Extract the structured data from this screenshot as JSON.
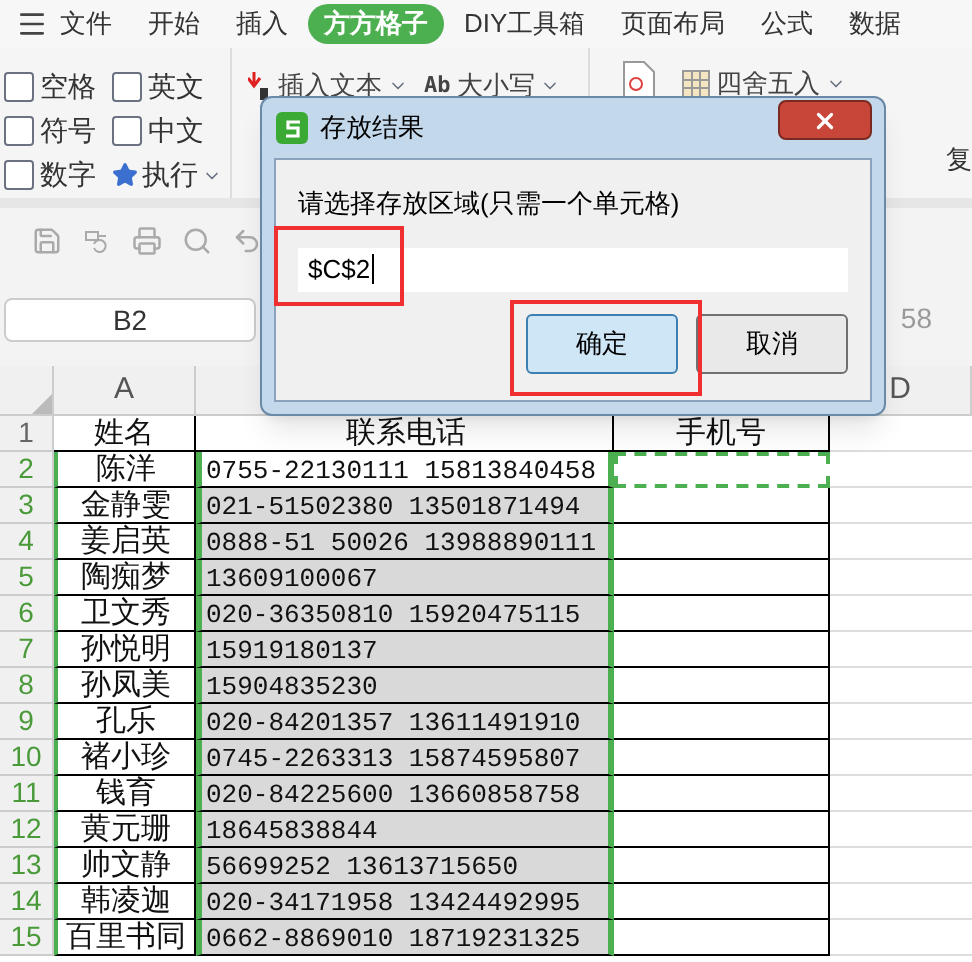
{
  "menu_bar": {
    "items": [
      {
        "label": "文件",
        "selected": false
      },
      {
        "label": "开始",
        "selected": false
      },
      {
        "label": "插入",
        "selected": false
      },
      {
        "label": "方方格子",
        "selected": true
      },
      {
        "label": "DIY工具箱",
        "selected": false
      },
      {
        "label": "页面布局",
        "selected": false
      },
      {
        "label": "公式",
        "selected": false
      },
      {
        "label": "数据",
        "selected": false
      }
    ]
  },
  "ribbon": {
    "checkboxes": [
      {
        "label": "空格",
        "checked": false
      },
      {
        "label": "英文",
        "checked": false
      },
      {
        "label": "符号",
        "checked": false
      },
      {
        "label": "中文",
        "checked": false
      },
      {
        "label": "数字",
        "checked": false
      }
    ],
    "execute_button": "执行",
    "insert_text_button": "插入文本",
    "case_button": {
      "glyph": "Ab",
      "label": "大小写"
    },
    "round_button": "四舍五入",
    "cut_label": "复"
  },
  "name_box": "B2",
  "formula_fragment": "58",
  "column_headers": {
    "first": "A",
    "last": "D"
  },
  "rows": [
    {
      "number": "1",
      "selected": false,
      "marked": false,
      "name": "姓名",
      "phone": "联系电话",
      "mobile": "手机号"
    },
    {
      "number": "2",
      "selected": true,
      "active": true,
      "marked": true,
      "name": "陈洋",
      "phone": "0755-22130111 15813840458"
    },
    {
      "number": "3",
      "selected": true,
      "active": false,
      "marked": false,
      "name": "金静雯",
      "phone": "021-51502380 13501871494"
    },
    {
      "number": "4",
      "selected": true,
      "active": false,
      "marked": false,
      "name": "姜启英",
      "phone": "0888-51 50026 13988890111"
    },
    {
      "number": "5",
      "selected": true,
      "active": false,
      "marked": false,
      "name": "陶痴梦",
      "phone": "13609100067"
    },
    {
      "number": "6",
      "selected": true,
      "active": false,
      "marked": false,
      "name": "卫文秀",
      "phone": "020-36350810 15920475115"
    },
    {
      "number": "7",
      "selected": true,
      "active": false,
      "marked": false,
      "name": "孙悦明",
      "phone": "15919180137"
    },
    {
      "number": "8",
      "selected": true,
      "active": false,
      "marked": false,
      "name": "孙凤美",
      "phone": "15904835230"
    },
    {
      "number": "9",
      "selected": true,
      "active": false,
      "marked": false,
      "name": "孔乐",
      "phone": "020-84201357 13611491910"
    },
    {
      "number": "10",
      "selected": true,
      "active": false,
      "marked": false,
      "name": "褚小珍",
      "phone": "0745-2263313 15874595807"
    },
    {
      "number": "11",
      "selected": true,
      "active": false,
      "marked": false,
      "name": "钱育",
      "phone": "020-84225600 13660858758"
    },
    {
      "number": "12",
      "selected": true,
      "active": false,
      "marked": false,
      "name": "黄元珊",
      "phone": "18645838844"
    },
    {
      "number": "13",
      "selected": true,
      "active": false,
      "marked": false,
      "name": "帅文静",
      "phone": "56699252 13613715650"
    },
    {
      "number": "14",
      "selected": true,
      "active": false,
      "marked": false,
      "name": "韩凌迦",
      "phone": "020-34171958 13424492995"
    },
    {
      "number": "15",
      "selected": true,
      "active": false,
      "marked": false,
      "name": "百里书同",
      "phone": "0662-8869010 18719231325"
    }
  ],
  "dialog": {
    "title": "存放结果",
    "prompt": "请选择存放区域(只需一个单元格)",
    "value": "$C$2",
    "ok_button": "确定",
    "cancel_button": "取消"
  }
}
